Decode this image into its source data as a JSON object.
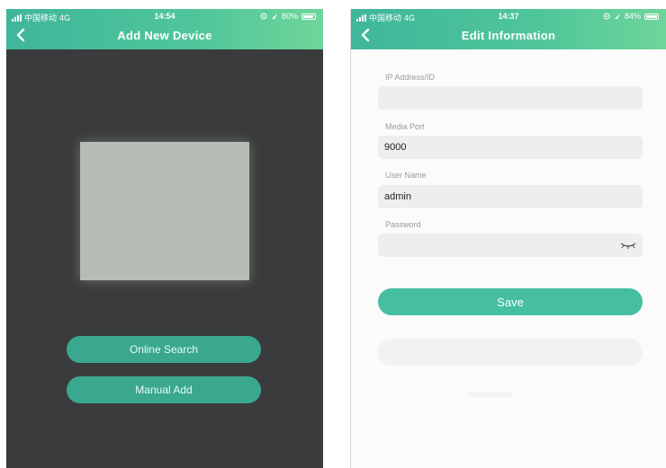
{
  "left_screen": {
    "status": {
      "carrier": "中国移动",
      "network": "4G",
      "time": "14:54",
      "battery": "80%",
      "battery_level": 0.8
    },
    "title": "Add New Device",
    "online_search_label": "Online Search",
    "manual_add_label": "Manual Add"
  },
  "right_screen": {
    "status": {
      "carrier": "中国移动",
      "network": "4G",
      "time": "14:37",
      "battery": "84%",
      "battery_level": 0.84
    },
    "title": "Edit Information",
    "fields": {
      "ip": {
        "label": "IP Address/ID",
        "value": ""
      },
      "port": {
        "label": "Media Port",
        "value": "9000"
      },
      "user": {
        "label": "User Name",
        "value": "admin"
      },
      "password": {
        "label": "Password",
        "value": ""
      }
    },
    "save_label": "Save"
  },
  "colors": {
    "header": "#4fc69a",
    "button": "#3aa88e",
    "save": "#45bfa0"
  },
  "icons": [
    "back-arrow-icon",
    "signal-icon",
    "battery-icon",
    "location-icon",
    "alarm-icon",
    "eye-closed-icon"
  ]
}
